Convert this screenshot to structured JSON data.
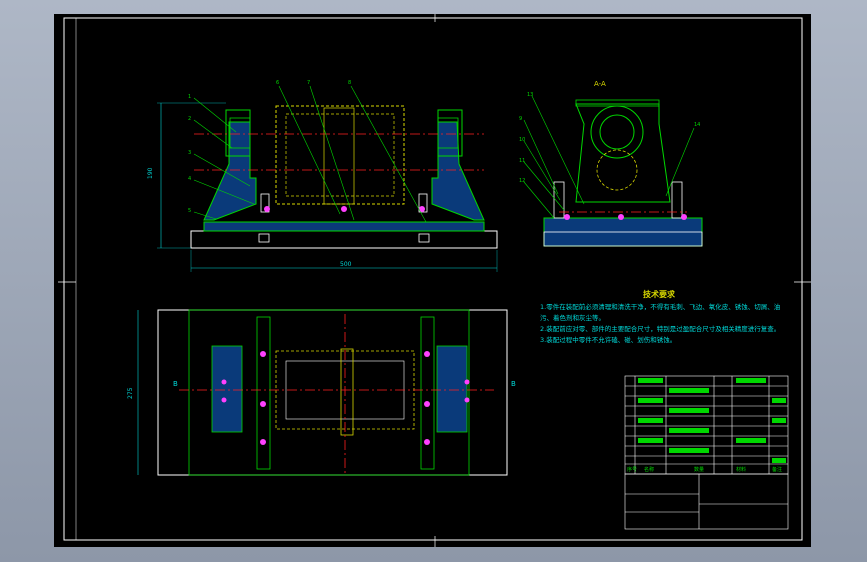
{
  "drawing": {
    "section_label": "A-A",
    "dimensions": {
      "overall_width": "500",
      "overall_height": "190",
      "plan_depth": "275"
    },
    "part_callouts": [
      "1",
      "2",
      "3",
      "4",
      "5",
      "6",
      "7",
      "8",
      "9",
      "10",
      "11",
      "12",
      "13",
      "14"
    ],
    "technical_notes": {
      "title": "技术要求",
      "items": [
        "1.零件在装配前必须清理和清洗干净，不得有毛刺、飞边、氧化皮、锈蚀、切屑、油",
        "污、着色剂和灰尘等。",
        "2.装配前应对零、部件的主要配合尺寸，特别是过盈配合尺寸及相关精度进行复查。",
        "3.装配过程中零件不允许磕、碰、划伤和锈蚀。"
      ]
    },
    "title_block": {
      "headers": [
        "序号",
        "名称",
        "数量",
        "材料",
        "备注"
      ]
    },
    "colors": {
      "background": "#000000",
      "outline": "#ffffff",
      "part": "#00d800",
      "hidden": "#d8d800",
      "center": "#ff2020",
      "dimension": "#00d8d8",
      "hatch": "#00a0ff",
      "highlight": "#ff40ff"
    }
  }
}
